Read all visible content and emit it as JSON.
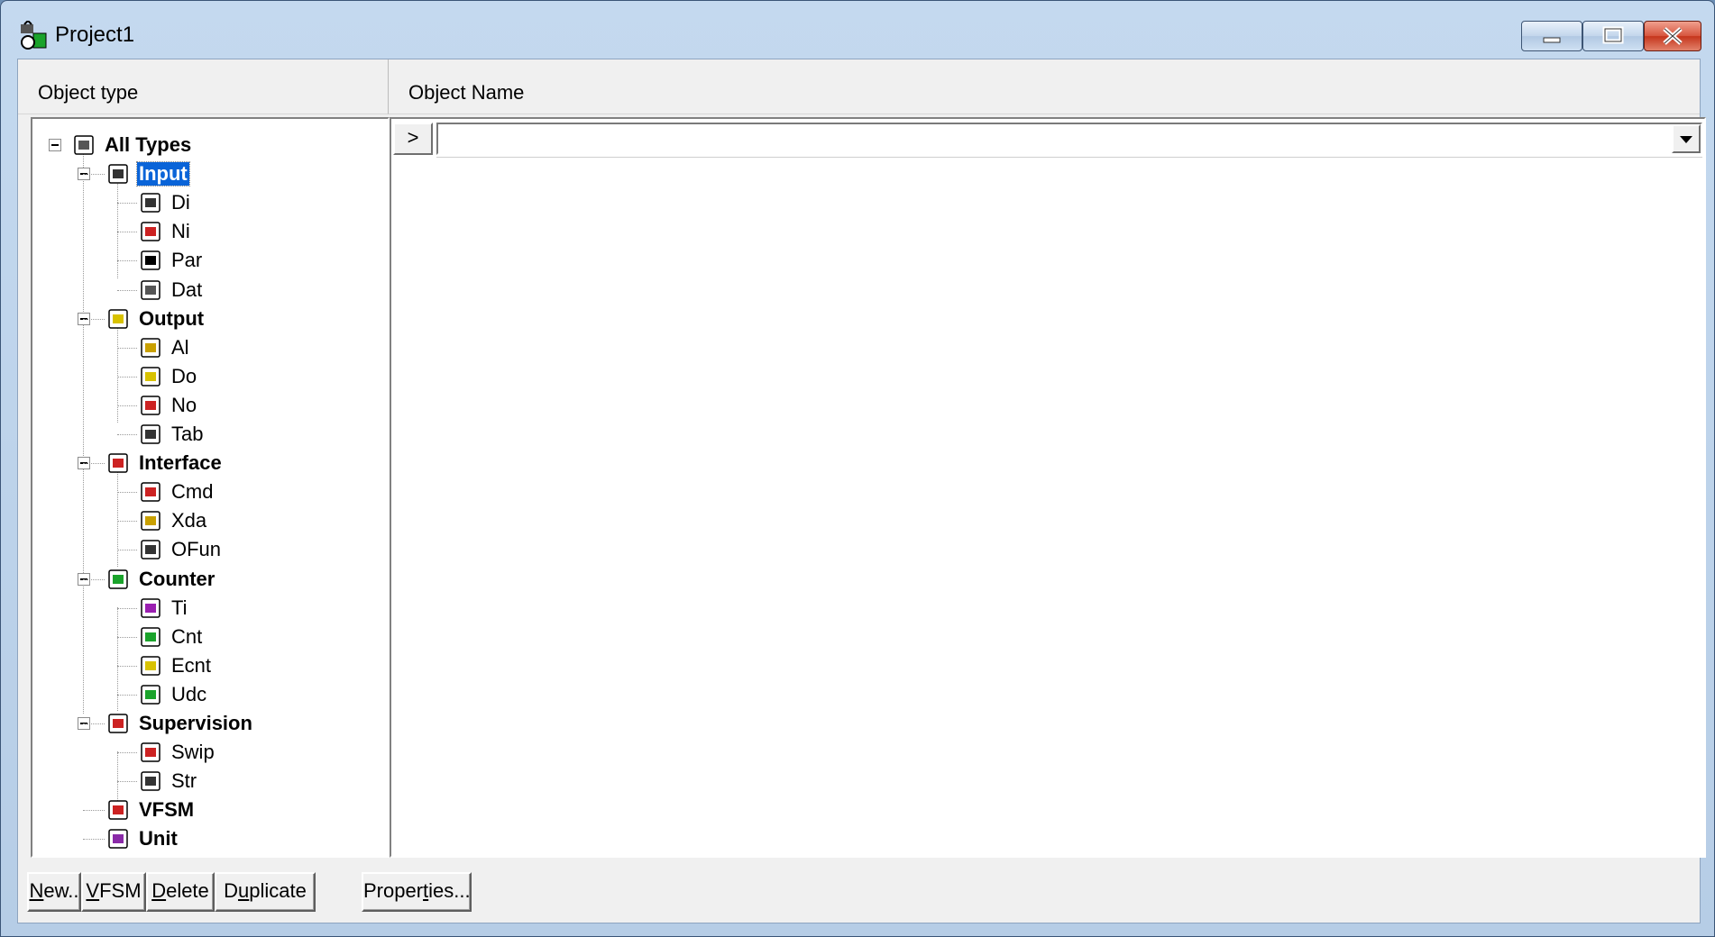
{
  "window": {
    "title": "Project1"
  },
  "headers": {
    "object_type": "Object type",
    "object_name": "Object Name"
  },
  "name_bar": {
    "go_label": ">",
    "combo_value": ""
  },
  "tree": [
    {
      "label": "All Types",
      "bold": true,
      "icon": "stack-icon"
    },
    {
      "label": "Input",
      "bold": true,
      "selected": true,
      "icon": "input-switch-icon"
    },
    {
      "label": "Di",
      "icon": "digital-input-icon"
    },
    {
      "label": "Ni",
      "icon": "numeric-input-icon"
    },
    {
      "label": "Par",
      "icon": "parameter-icon"
    },
    {
      "label": "Dat",
      "icon": "data-stack-icon"
    },
    {
      "label": "Output",
      "bold": true,
      "icon": "lightbulb-icon"
    },
    {
      "label": "Al",
      "icon": "alarm-bell-icon"
    },
    {
      "label": "Do",
      "icon": "digital-output-icon"
    },
    {
      "label": "No",
      "icon": "numeric-output-icon"
    },
    {
      "label": "Tab",
      "icon": "table-icon"
    },
    {
      "label": "Interface",
      "bold": true,
      "icon": "interface-icon"
    },
    {
      "label": "Cmd",
      "icon": "command-hand-icon"
    },
    {
      "label": "Xda",
      "icon": "xda-icon"
    },
    {
      "label": "OFun",
      "icon": "ofun-icon"
    },
    {
      "label": "Counter",
      "bold": true,
      "icon": "counter-icon"
    },
    {
      "label": "Ti",
      "icon": "timer-clock-icon"
    },
    {
      "label": "Cnt",
      "icon": "cnt-icon"
    },
    {
      "label": "Ecnt",
      "icon": "event-counter-icon"
    },
    {
      "label": "Udc",
      "icon": "updown-counter-icon"
    },
    {
      "label": "Supervision",
      "bold": true,
      "icon": "supervision-icon"
    },
    {
      "label": "Swip",
      "icon": "swip-icon"
    },
    {
      "label": "Str",
      "icon": "string-re-icon"
    },
    {
      "label": "VFSM",
      "bold": true,
      "icon": "vfsm-graph-icon"
    },
    {
      "label": "Unit",
      "bold": true,
      "icon": "unit-house-icon"
    }
  ],
  "buttons": {
    "new": {
      "pre": "",
      "u": "N",
      "post": "ew.."
    },
    "vfsm": {
      "pre": "",
      "u": "V",
      "post": "FSM"
    },
    "delete": {
      "pre": "",
      "u": "D",
      "post": "elete"
    },
    "duplicate": {
      "pre": "D",
      "u": "u",
      "post": "plicate"
    },
    "properties": {
      "pre": "Proper",
      "u": "t",
      "post": "ies..."
    }
  },
  "colors": {
    "selection": "#0a64d8",
    "window_frame": "#b6cde6",
    "close_button": "#c5351c"
  }
}
